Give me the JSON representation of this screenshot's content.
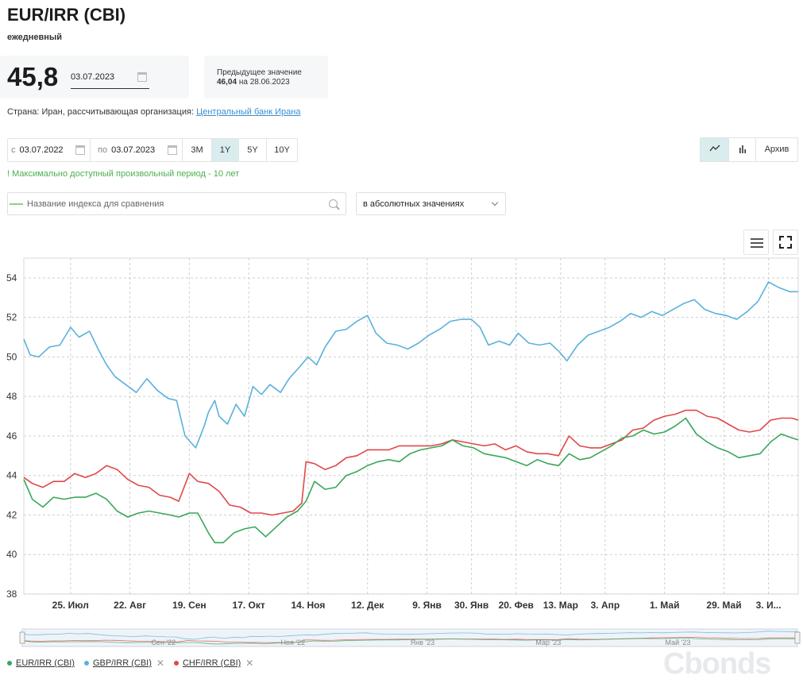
{
  "header": {
    "title": "EUR/IRR (CBI)",
    "frequency": "ежедневный"
  },
  "current": {
    "value": "45,8",
    "date": "03.07.2023"
  },
  "previous": {
    "label": "Предыдущее значение",
    "value": "46,04",
    "on": "на",
    "date": "28.06.2023"
  },
  "source": {
    "text": "Страна: Иран, рассчитывающая организация:",
    "link": "Центральный банк Ирана"
  },
  "period": {
    "from_prefix": "с",
    "from_date": "03.07.2022",
    "to_prefix": "по",
    "to_date": "03.07.2023",
    "buttons": [
      "3M",
      "1Y",
      "5Y",
      "10Y"
    ],
    "active": "1Y",
    "note": "! Максимально доступный произвольный период - 10 лет"
  },
  "view": {
    "archive_label": "Архив",
    "line_icon": "line-chart-icon",
    "bar_icon": "bar-chart-icon"
  },
  "compare": {
    "placeholder": "Название индекса для сравнения",
    "mode": "в абсолютных значениях"
  },
  "legend": [
    {
      "name": "EUR/IRR (CBI)",
      "color": "#3aa65a",
      "removable": false
    },
    {
      "name": "GBP/IRR (CBI)",
      "color": "#5bb1dc",
      "removable": true
    },
    {
      "name": "CHF/IRR (CBI)",
      "color": "#e04848",
      "removable": true
    }
  ],
  "navigator_labels": [
    "Сен '22",
    "Ноя '22",
    "Янв '23",
    "Мар '23",
    "Май '23"
  ],
  "watermark": "Cbonds",
  "chart_data": {
    "type": "line",
    "ylim": [
      38,
      55
    ],
    "yticks": [
      38,
      40,
      42,
      44,
      46,
      48,
      50,
      52,
      54
    ],
    "xlim": [
      "2022-07-03",
      "2023-07-03"
    ],
    "xticks": [
      {
        "date": "2022-07-25",
        "label": "25. Июл"
      },
      {
        "date": "2022-08-22",
        "label": "22. Авг"
      },
      {
        "date": "2022-09-19",
        "label": "19. Сен"
      },
      {
        "date": "2022-10-17",
        "label": "17. Окт"
      },
      {
        "date": "2022-11-14",
        "label": "14. Ноя"
      },
      {
        "date": "2022-12-12",
        "label": "12. Дек"
      },
      {
        "date": "2023-01-09",
        "label": "9. Янв"
      },
      {
        "date": "2023-01-30",
        "label": "30. Янв"
      },
      {
        "date": "2023-02-20",
        "label": "20. Фев"
      },
      {
        "date": "2023-03-13",
        "label": "13. Мар"
      },
      {
        "date": "2023-04-03",
        "label": "3. Апр"
      },
      {
        "date": "2023-05-01",
        "label": "1. Май"
      },
      {
        "date": "2023-05-29",
        "label": "29. Май"
      },
      {
        "date": "2023-06-19",
        "label": "3. И..."
      }
    ],
    "grid": true,
    "series": [
      {
        "name": "GBP/IRR (CBI)",
        "color": "#5bb1dc",
        "x": [
          "2022-07-03",
          "2022-07-06",
          "2022-07-10",
          "2022-07-15",
          "2022-07-20",
          "2022-07-25",
          "2022-07-29",
          "2022-08-03",
          "2022-08-07",
          "2022-08-11",
          "2022-08-15",
          "2022-08-20",
          "2022-08-25",
          "2022-08-30",
          "2022-09-04",
          "2022-09-09",
          "2022-09-13",
          "2022-09-17",
          "2022-09-22",
          "2022-09-26",
          "2022-09-28",
          "2022-10-01",
          "2022-10-03",
          "2022-10-07",
          "2022-10-11",
          "2022-10-15",
          "2022-10-19",
          "2022-10-23",
          "2022-10-27",
          "2022-11-01",
          "2022-11-05",
          "2022-11-10",
          "2022-11-14",
          "2022-11-18",
          "2022-11-22",
          "2022-11-27",
          "2022-12-02",
          "2022-12-07",
          "2022-12-12",
          "2022-12-16",
          "2022-12-21",
          "2022-12-26",
          "2022-12-31",
          "2023-01-05",
          "2023-01-10",
          "2023-01-15",
          "2023-01-20",
          "2023-01-25",
          "2023-01-30",
          "2023-02-03",
          "2023-02-07",
          "2023-02-12",
          "2023-02-17",
          "2023-02-21",
          "2023-02-26",
          "2023-03-03",
          "2023-03-08",
          "2023-03-12",
          "2023-03-16",
          "2023-03-21",
          "2023-03-26",
          "2023-03-31",
          "2023-04-05",
          "2023-04-10",
          "2023-04-15",
          "2023-04-20",
          "2023-04-25",
          "2023-04-30",
          "2023-05-05",
          "2023-05-10",
          "2023-05-15",
          "2023-05-20",
          "2023-05-25",
          "2023-05-30",
          "2023-06-04",
          "2023-06-09",
          "2023-06-14",
          "2023-06-19",
          "2023-06-24",
          "2023-06-29",
          "2023-07-03"
        ],
        "y": [
          50.9,
          50.1,
          50.0,
          50.5,
          50.6,
          51.5,
          51.0,
          51.3,
          50.4,
          49.6,
          49.0,
          48.6,
          48.2,
          48.9,
          48.3,
          47.9,
          47.8,
          46.0,
          45.4,
          46.5,
          47.2,
          47.8,
          47.0,
          46.6,
          47.6,
          47.0,
          48.5,
          48.1,
          48.6,
          48.2,
          48.9,
          49.5,
          50.0,
          49.6,
          50.5,
          51.3,
          51.4,
          51.8,
          52.1,
          51.2,
          50.7,
          50.6,
          50.4,
          50.7,
          51.1,
          51.4,
          51.8,
          51.9,
          51.9,
          51.5,
          50.6,
          50.8,
          50.6,
          51.2,
          50.7,
          50.6,
          50.7,
          50.3,
          49.8,
          50.6,
          51.1,
          51.3,
          51.5,
          51.8,
          52.2,
          52.0,
          52.3,
          52.1,
          52.4,
          52.7,
          52.9,
          52.4,
          52.2,
          52.1,
          51.9,
          52.3,
          52.8,
          53.8,
          53.5,
          53.3,
          53.3
        ]
      },
      {
        "name": "CHF/IRR (CBI)",
        "color": "#e04848",
        "x": [
          "2022-07-03",
          "2022-07-07",
          "2022-07-12",
          "2022-07-17",
          "2022-07-22",
          "2022-07-27",
          "2022-08-01",
          "2022-08-06",
          "2022-08-11",
          "2022-08-16",
          "2022-08-21",
          "2022-08-26",
          "2022-08-31",
          "2022-09-05",
          "2022-09-10",
          "2022-09-14",
          "2022-09-19",
          "2022-09-23",
          "2022-09-28",
          "2022-10-03",
          "2022-10-08",
          "2022-10-13",
          "2022-10-18",
          "2022-10-23",
          "2022-10-28",
          "2022-11-02",
          "2022-11-07",
          "2022-11-11",
          "2022-11-13",
          "2022-11-17",
          "2022-11-22",
          "2022-11-27",
          "2022-12-02",
          "2022-12-07",
          "2022-12-12",
          "2022-12-17",
          "2022-12-22",
          "2022-12-27",
          "2023-01-01",
          "2023-01-06",
          "2023-01-11",
          "2023-01-16",
          "2023-01-21",
          "2023-01-26",
          "2023-01-31",
          "2023-02-05",
          "2023-02-10",
          "2023-02-15",
          "2023-02-20",
          "2023-02-25",
          "2023-03-02",
          "2023-03-07",
          "2023-03-12",
          "2023-03-17",
          "2023-03-22",
          "2023-03-27",
          "2023-04-01",
          "2023-04-06",
          "2023-04-11",
          "2023-04-16",
          "2023-04-21",
          "2023-04-26",
          "2023-05-01",
          "2023-05-06",
          "2023-05-11",
          "2023-05-16",
          "2023-05-21",
          "2023-05-26",
          "2023-05-31",
          "2023-06-05",
          "2023-06-10",
          "2023-06-15",
          "2023-06-20",
          "2023-06-25",
          "2023-06-30",
          "2023-07-03"
        ],
        "y": [
          43.9,
          43.6,
          43.4,
          43.7,
          43.7,
          44.1,
          43.9,
          44.1,
          44.5,
          44.3,
          43.8,
          43.5,
          43.4,
          43.0,
          42.9,
          42.7,
          44.1,
          43.7,
          43.6,
          43.2,
          42.5,
          42.4,
          42.1,
          42.1,
          42.0,
          42.1,
          42.2,
          42.6,
          44.7,
          44.6,
          44.3,
          44.5,
          44.9,
          45.0,
          45.3,
          45.3,
          45.3,
          45.5,
          45.5,
          45.5,
          45.5,
          45.6,
          45.8,
          45.7,
          45.6,
          45.5,
          45.6,
          45.3,
          45.5,
          45.2,
          45.1,
          45.1,
          45.0,
          46.0,
          45.5,
          45.4,
          45.4,
          45.6,
          45.8,
          46.3,
          46.4,
          46.8,
          47.0,
          47.1,
          47.3,
          47.3,
          47.0,
          46.9,
          46.6,
          46.3,
          46.2,
          46.3,
          46.8,
          46.9,
          46.9,
          46.8
        ]
      },
      {
        "name": "EUR/IRR (CBI)",
        "color": "#3aa65a",
        "x": [
          "2022-07-03",
          "2022-07-07",
          "2022-07-12",
          "2022-07-17",
          "2022-07-22",
          "2022-07-27",
          "2022-08-01",
          "2022-08-06",
          "2022-08-11",
          "2022-08-16",
          "2022-08-21",
          "2022-08-26",
          "2022-08-31",
          "2022-09-05",
          "2022-09-10",
          "2022-09-14",
          "2022-09-19",
          "2022-09-23",
          "2022-09-28",
          "2022-10-01",
          "2022-10-05",
          "2022-10-10",
          "2022-10-15",
          "2022-10-20",
          "2022-10-25",
          "2022-10-30",
          "2022-11-04",
          "2022-11-09",
          "2022-11-13",
          "2022-11-17",
          "2022-11-22",
          "2022-11-27",
          "2022-12-02",
          "2022-12-07",
          "2022-12-12",
          "2022-12-17",
          "2022-12-22",
          "2022-12-27",
          "2023-01-01",
          "2023-01-06",
          "2023-01-11",
          "2023-01-16",
          "2023-01-21",
          "2023-01-26",
          "2023-01-31",
          "2023-02-05",
          "2023-02-10",
          "2023-02-15",
          "2023-02-20",
          "2023-02-25",
          "2023-03-02",
          "2023-03-07",
          "2023-03-12",
          "2023-03-17",
          "2023-03-22",
          "2023-03-27",
          "2023-04-01",
          "2023-04-06",
          "2023-04-11",
          "2023-04-16",
          "2023-04-21",
          "2023-04-26",
          "2023-05-01",
          "2023-05-06",
          "2023-05-11",
          "2023-05-16",
          "2023-05-21",
          "2023-05-26",
          "2023-05-31",
          "2023-06-05",
          "2023-06-10",
          "2023-06-15",
          "2023-06-20",
          "2023-06-25",
          "2023-06-30",
          "2023-07-03"
        ],
        "y": [
          43.8,
          42.8,
          42.4,
          42.9,
          42.8,
          42.9,
          42.9,
          43.1,
          42.8,
          42.2,
          41.9,
          42.1,
          42.2,
          42.1,
          42.0,
          41.9,
          42.1,
          42.1,
          41.1,
          40.6,
          40.6,
          41.1,
          41.3,
          41.4,
          40.9,
          41.4,
          41.9,
          42.2,
          42.7,
          43.7,
          43.3,
          43.4,
          44.0,
          44.2,
          44.5,
          44.7,
          44.8,
          44.7,
          45.1,
          45.3,
          45.4,
          45.5,
          45.8,
          45.5,
          45.4,
          45.1,
          45.0,
          44.9,
          44.7,
          44.5,
          44.8,
          44.6,
          44.5,
          45.1,
          44.8,
          44.9,
          45.2,
          45.5,
          45.9,
          46.0,
          46.3,
          46.1,
          46.2,
          46.5,
          46.9,
          46.1,
          45.7,
          45.4,
          45.2,
          44.9,
          45.0,
          45.1,
          45.7,
          46.1,
          45.9,
          45.8
        ]
      }
    ]
  }
}
